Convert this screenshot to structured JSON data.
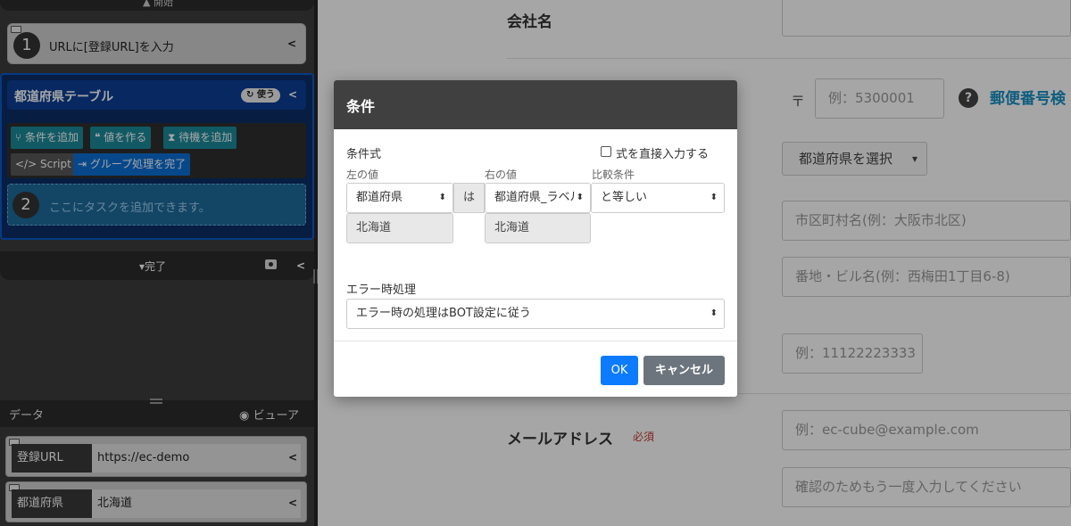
{
  "left_panel": {
    "top_bar_text": "▲ 開始",
    "task1": {
      "number": "1",
      "label": "URLに[登録URL]を入力"
    },
    "group": {
      "title": "都道府県テーブル",
      "use_badge": "使う",
      "buttons": {
        "add_condition": "条件を追加",
        "make_value": "値を作る",
        "add_wait": "待機を追加",
        "script": "Script",
        "finish_group": "グループ処理を完了"
      },
      "dropzone": {
        "number": "2",
        "label": "ここにタスクを追加できます。"
      }
    },
    "done_label": "完了",
    "data_panel": {
      "title": "データ",
      "viewer": "ビューア",
      "rows": [
        {
          "name": "登録URL",
          "value": "https://ec-demo"
        },
        {
          "name": "都道府県",
          "value": "北海道"
        }
      ]
    }
  },
  "form": {
    "company_label": "会社名",
    "zip_mark": "〒",
    "zip_placeholder": "例：5300001",
    "zip_lookup_link": "郵便番号検",
    "pref_select": "都道府県を選択",
    "city_placeholder": "市区町村名(例：大阪市北区)",
    "address_placeholder": "番地・ビル名(例：西梅田1丁目6-8)",
    "phone_placeholder": "例：11122223333",
    "email_label": "メールアドレス",
    "required": "必須",
    "email_placeholder": "例：ec-cube@example.com",
    "email_confirm_placeholder": "確認のためもう一度入力してください"
  },
  "modal": {
    "title": "条件",
    "expression_label": "条件式",
    "direct_input_label": "式を直接入力する",
    "left_value_label": "左の値",
    "right_value_label": "右の値",
    "compare_label": "比較条件",
    "left_select": "都道府県",
    "is_text": "は",
    "right_select": "都道府県_ラベル",
    "compare_select": "と等しい",
    "left_preview": "北海道",
    "right_preview": "北海道",
    "error_label": "エラー時処理",
    "error_select": "エラー時の処理はBOT設定に従う",
    "ok": "OK",
    "cancel": "キャンセル"
  },
  "colors": {
    "group_header": "#0b3e96",
    "teal_button": "#1b8a9a",
    "blue_button": "#0b6fd6",
    "ok_button": "#0d7bff",
    "cancel_button": "#6c757d",
    "modal_header": "#404040",
    "link": "#1a8fc4"
  }
}
